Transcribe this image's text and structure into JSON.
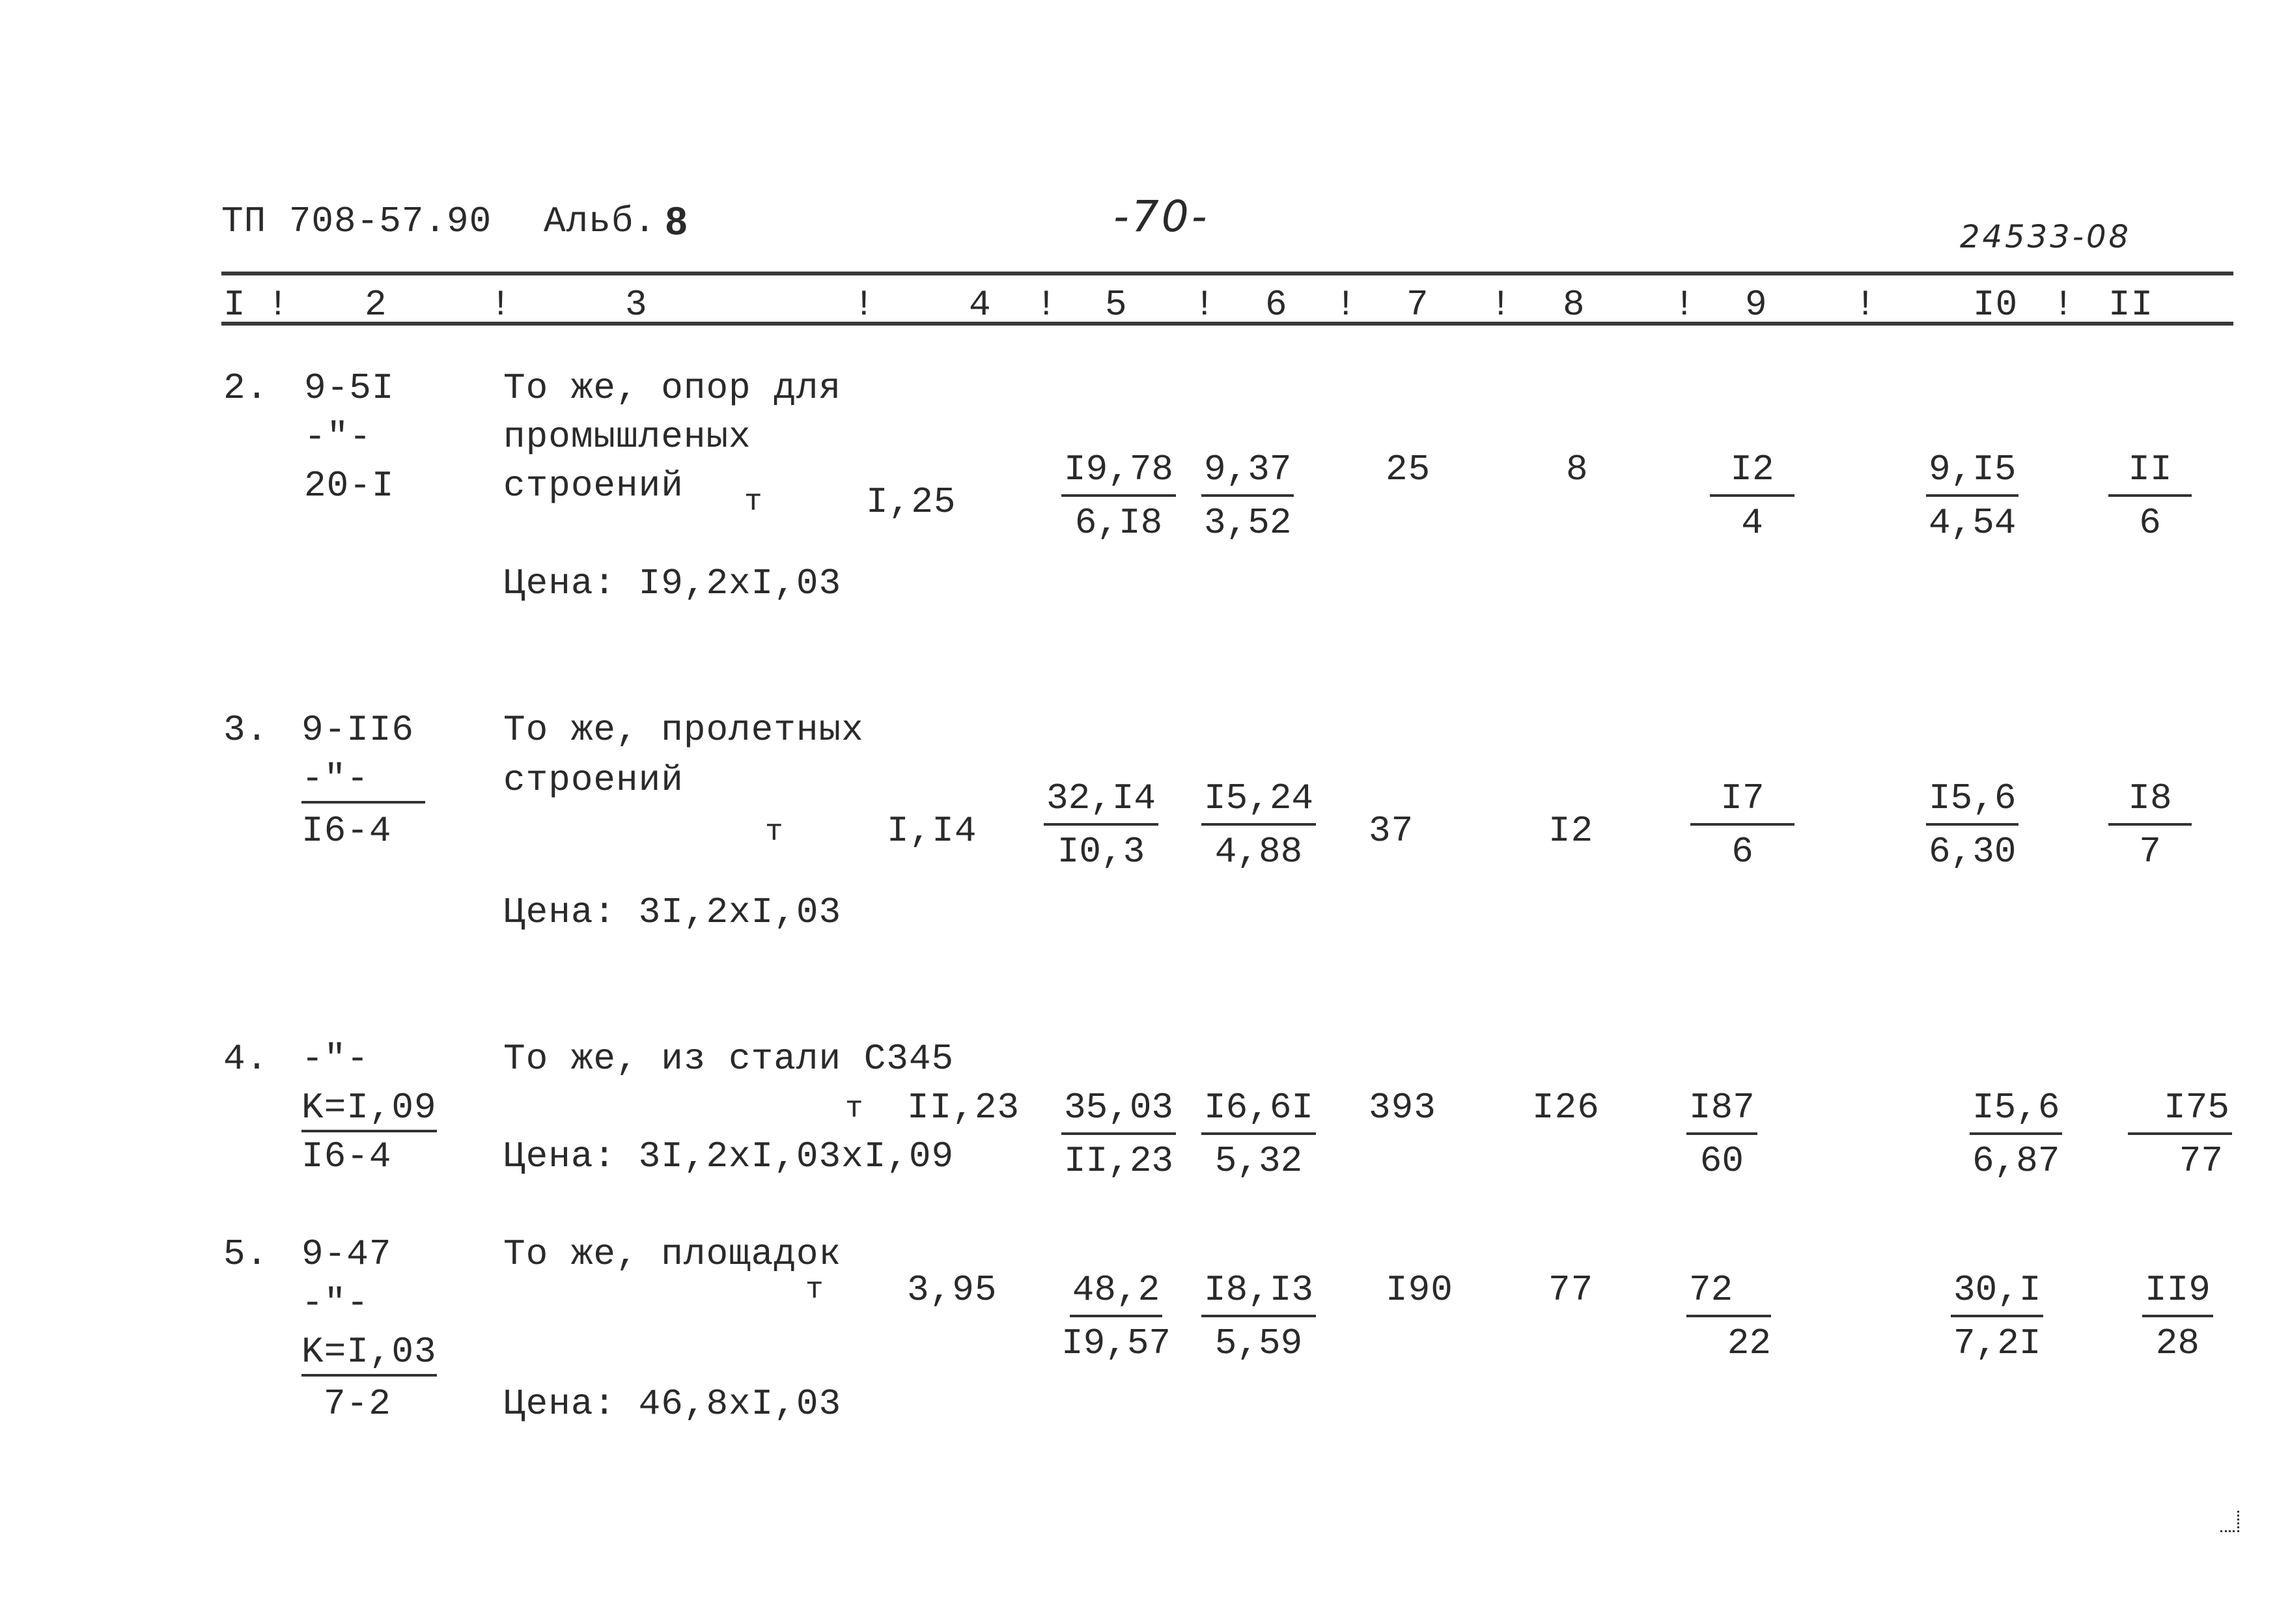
{
  "header": {
    "doc_code": "ТП 708-57.90",
    "album_label": "Альб.",
    "album_number": "8",
    "page_number": "-70-",
    "stamp": "24533-08"
  },
  "columns": [
    "I",
    "!",
    "2",
    "!",
    "3",
    "!",
    "4",
    "!",
    "5",
    "!",
    "6",
    "!",
    "7",
    "!",
    "8",
    "!",
    "9",
    "!",
    "I0",
    "!",
    "II"
  ],
  "rows": [
    {
      "num": "2.",
      "code_lines": [
        "9-5I",
        "-\"-",
        "20-I"
      ],
      "description": [
        "То же, опор для",
        "промышленых",
        "строений"
      ],
      "unit": "т",
      "col4": "I,25",
      "col5": {
        "num": "I9,78",
        "den": "6,I8"
      },
      "col6": {
        "num": "9,37",
        "den": "3,52"
      },
      "col7": "25",
      "col8": "8",
      "col9": {
        "num": "I2",
        "den": "4"
      },
      "col10": {
        "num": "9,I5",
        "den": "4,54"
      },
      "col11": {
        "num": "II",
        "den": "6"
      },
      "price": "Цена: I9,2xI,03"
    },
    {
      "num": "3.",
      "code_lines": [
        "9-II6",
        "-\"-",
        "I6-4"
      ],
      "description": [
        "То же, пролетных",
        "строений"
      ],
      "unit": "т",
      "col4": "I,I4",
      "col5": {
        "num": "32,I4",
        "den": "I0,3"
      },
      "col6": {
        "num": "I5,24",
        "den": "4,88"
      },
      "col7": "37",
      "col8": "I2",
      "col9": {
        "num": "I7",
        "den": "6"
      },
      "col10": {
        "num": "I5,6",
        "den": "6,30"
      },
      "col11": {
        "num": "I8",
        "den": "7"
      },
      "price": "Цена: 3I,2xI,03"
    },
    {
      "num": "4.",
      "code_lines": [
        "-\"-",
        "K=I,09",
        "I6-4"
      ],
      "description": [
        "То же, из стали С345"
      ],
      "unit": "т",
      "col4": "II,23",
      "col5": {
        "num": "35,03",
        "den": "II,23"
      },
      "col6": {
        "num": "I6,6I",
        "den": "5,32"
      },
      "col7": "393",
      "col8": "I26",
      "col9": {
        "num": "I87",
        "den": "60"
      },
      "col10": {
        "num": "I5,6",
        "den": "6,87"
      },
      "col11": {
        "num": "I75",
        "den": "77"
      },
      "price": "Цена: 3I,2xI,03xI,09"
    },
    {
      "num": "5.",
      "code_lines": [
        "9-47",
        "-\"-",
        "K=I,03",
        "7-2"
      ],
      "description": [
        "То же, площадок"
      ],
      "unit": "т",
      "col4": "3,95",
      "col5": {
        "num": "48,2",
        "den": "I9,57"
      },
      "col6": {
        "num": "I8,I3",
        "den": "5,59"
      },
      "col7": "I90",
      "col8": "77",
      "col9": {
        "num": "72",
        "den": "22"
      },
      "col10": {
        "num": "30,I",
        "den": "7,2I"
      },
      "col11": {
        "num": "II9",
        "den": "28"
      },
      "price": "Цена: 46,8xI,03"
    }
  ]
}
